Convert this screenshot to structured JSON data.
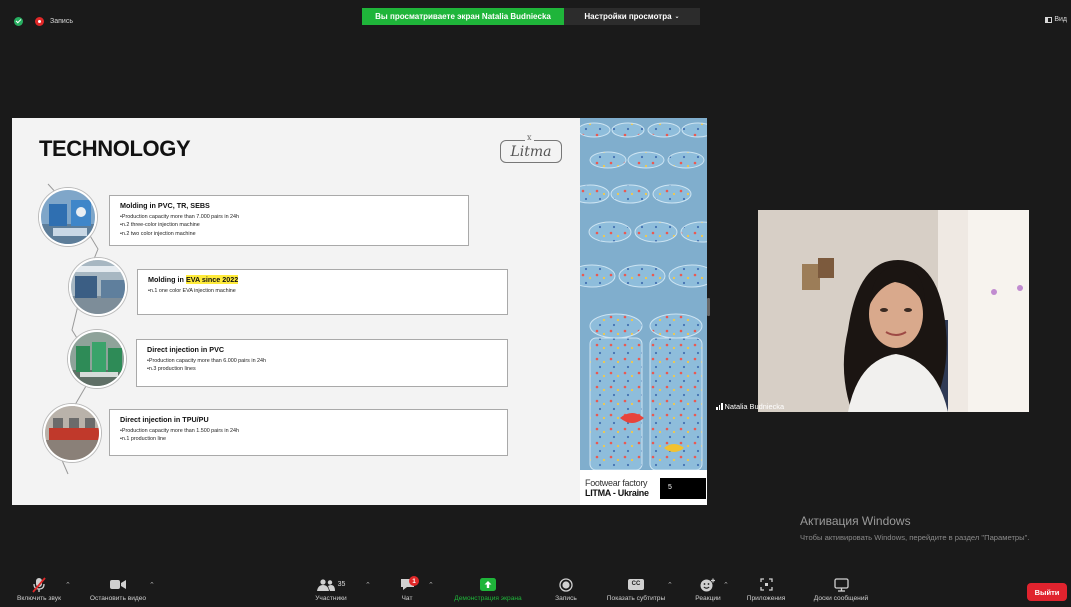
{
  "top_bar": {
    "recording_label": "Запись",
    "share_banner": "Вы просматриваете экран Natalia Budniecka",
    "view_options": "Настройки просмотра",
    "view_label": "Вид"
  },
  "slide": {
    "title": "TECHNOLOGY",
    "logo": "Litma",
    "logo_mark": "x",
    "items": [
      {
        "title": "Molding in PVC, TR, SEBS",
        "lines": [
          "•Production capacity more than 7.000 pairs in 24h",
          "•n.2 three-color injection machine",
          "•n.2 two color injection machine"
        ]
      },
      {
        "title_prefix": "Molding in ",
        "title_highlight": "EVA since 2022",
        "lines": [
          "•n.1 one color EVA injection machine"
        ]
      },
      {
        "title": "Direct injection in PVC",
        "lines": [
          "•Production capacity more than 6.000 pairs in 24h",
          "•n.3 production lines"
        ]
      },
      {
        "title": "Direct injection in TPU/PU",
        "lines": [
          "•Production capacity more than 1.500 pairs in 24h",
          "•n.1 production line"
        ]
      }
    ],
    "footer_subtitle": "Footwear factory",
    "footer_title": "LITMA - Ukraine",
    "page_number": "5",
    "highlight_color": "#ffeb3b"
  },
  "video": {
    "speaker_name": "Natalia Budniecka"
  },
  "windows_activation": {
    "title": "Активация Windows",
    "subtitle": "Чтобы активировать Windows, перейдите в раздел \"Параметры\"."
  },
  "toolbar": {
    "unmute": "Включить звук",
    "stop_video": "Остановить видео",
    "participants": "Участники",
    "participants_count": "35",
    "chat": "Чат",
    "chat_badge": "1",
    "share_screen": "Демонстрация экрана",
    "record": "Запись",
    "captions": "Показать субтитры",
    "captions_icon_text": "CC",
    "reactions": "Реакции",
    "apps": "Приложения",
    "whiteboards": "Доски сообщений",
    "leave": "Выйти",
    "share_color": "#1fb53a",
    "leave_color": "#e0232e"
  }
}
